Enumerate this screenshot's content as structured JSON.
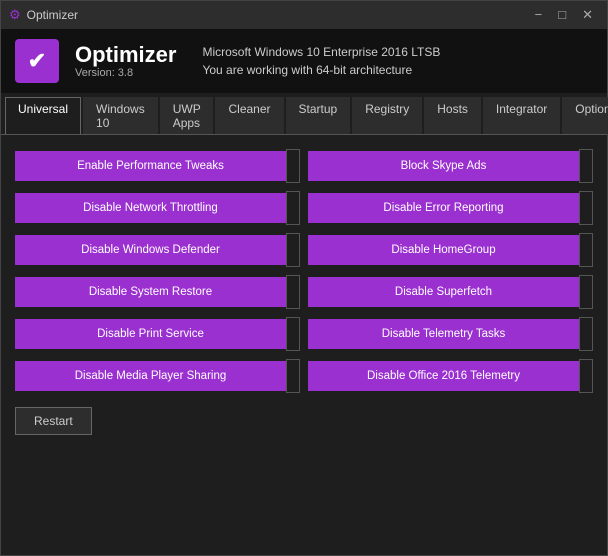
{
  "titleBar": {
    "icon": "⚙",
    "text": "Optimizer",
    "controls": {
      "minimize": "−",
      "maximize": "□",
      "close": "✕"
    }
  },
  "header": {
    "appName": "Optimizer",
    "version": "Version: 3.8",
    "infoLine1": "Microsoft Windows 10 Enterprise 2016 LTSB",
    "infoLine2": "You are working with 64-bit architecture"
  },
  "tabs": [
    {
      "label": "Universal",
      "active": true
    },
    {
      "label": "Windows 10",
      "active": false
    },
    {
      "label": "UWP Apps",
      "active": false
    },
    {
      "label": "Cleaner",
      "active": false
    },
    {
      "label": "Startup",
      "active": false
    },
    {
      "label": "Registry",
      "active": false
    },
    {
      "label": "Hosts",
      "active": false
    },
    {
      "label": "Integrator",
      "active": false
    },
    {
      "label": "Options",
      "active": false
    }
  ],
  "buttons": [
    [
      {
        "label": "Enable Performance Tweaks"
      },
      {
        "label": "Block Skype Ads"
      }
    ],
    [
      {
        "label": "Disable Network Throttling"
      },
      {
        "label": "Disable Error Reporting"
      }
    ],
    [
      {
        "label": "Disable Windows Defender"
      },
      {
        "label": "Disable HomeGroup"
      }
    ],
    [
      {
        "label": "Disable System Restore"
      },
      {
        "label": "Disable Superfetch"
      }
    ],
    [
      {
        "label": "Disable Print Service"
      },
      {
        "label": "Disable Telemetry Tasks"
      }
    ],
    [
      {
        "label": "Disable Media Player Sharing"
      },
      {
        "label": "Disable Office 2016 Telemetry"
      }
    ]
  ],
  "restartButton": "Restart"
}
